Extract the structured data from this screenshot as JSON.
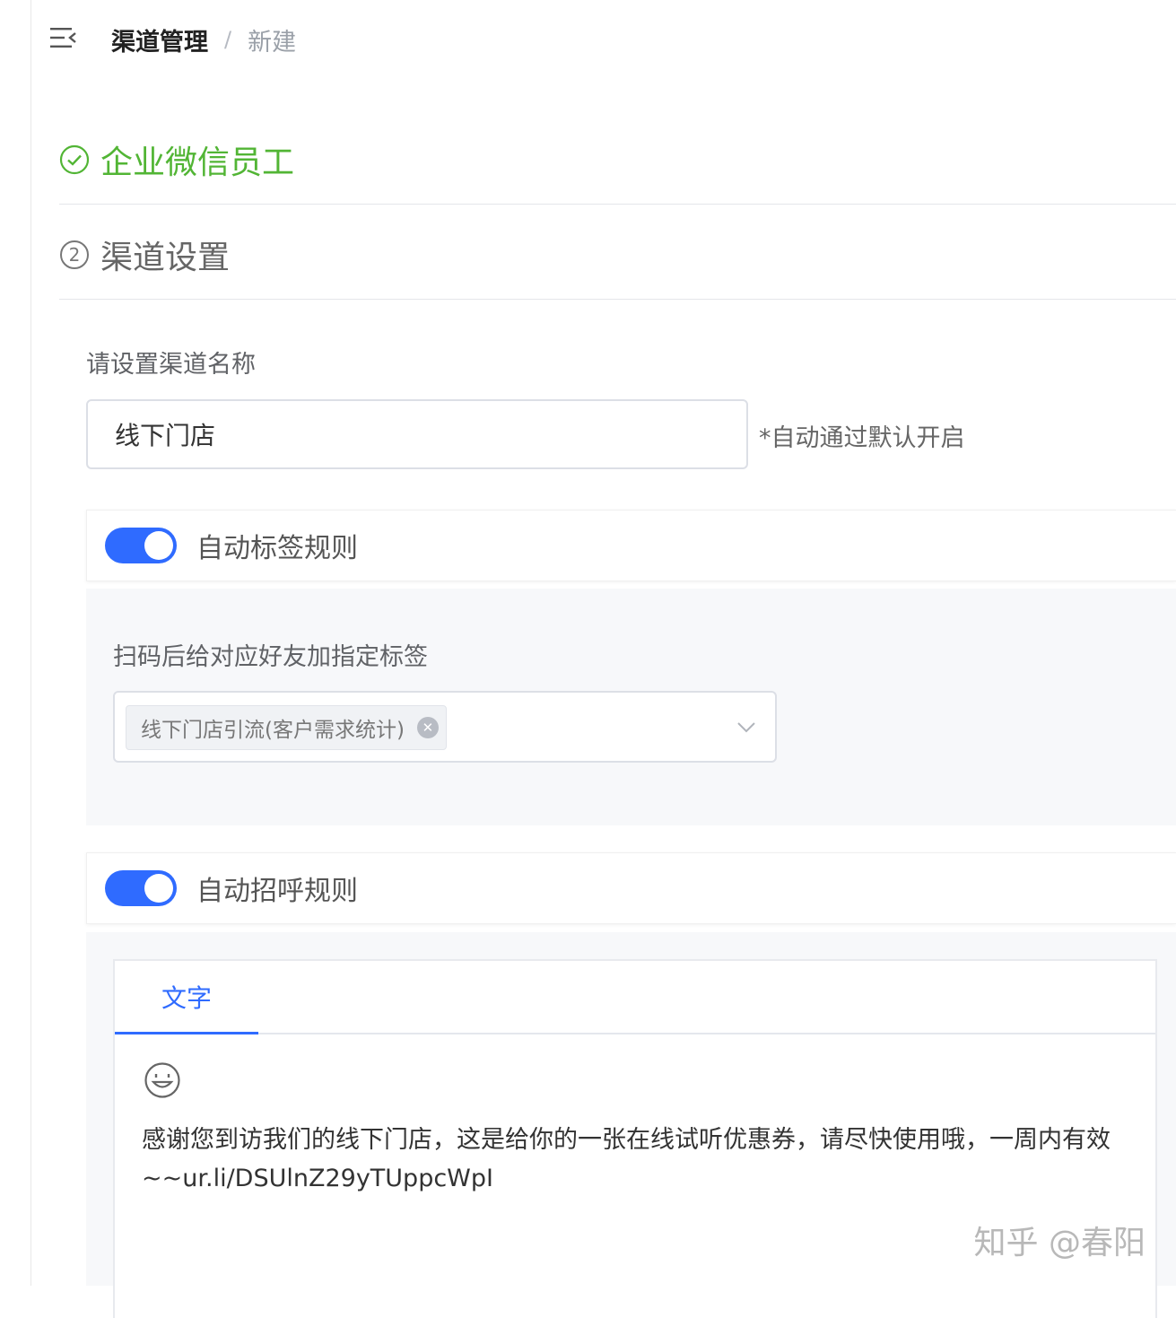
{
  "breadcrumb": {
    "parent": "渠道管理",
    "separator": "/",
    "current": "新建"
  },
  "steps": [
    {
      "label": "企业微信员工",
      "state": "done",
      "color": "#52b535"
    },
    {
      "label": "渠道设置",
      "number": "②",
      "state": "active"
    }
  ],
  "channel_name": {
    "label": "请设置渠道名称",
    "value": "线下门店",
    "hint": "*自动通过默认开启"
  },
  "tag_rule": {
    "title": "自动标签规则",
    "enabled": true,
    "field_label": "扫码后给对应好友加指定标签",
    "selected_tags": [
      "线下门店引流(客户需求统计)"
    ]
  },
  "greeting_rule": {
    "title": "自动招呼规则",
    "enabled": true,
    "tabs": [
      "文字"
    ],
    "active_tab": "文字",
    "message": "感谢您到访我们的线下门店，这是给你的一张在线试听优惠券，请尽快使用哦，一周内有效~~ur.li/DSUlnZ29yTUppcWpI"
  },
  "watermark": "知乎 @春阳",
  "icons": {
    "menu": "menu-fold-icon",
    "done": "check-circle-icon",
    "dropdown": "chevron-down-icon",
    "emoji": "emoji-smile-icon",
    "remove_tag": "close-circle-icon"
  },
  "colors": {
    "accent": "#2f6bff",
    "success": "#52b535"
  }
}
